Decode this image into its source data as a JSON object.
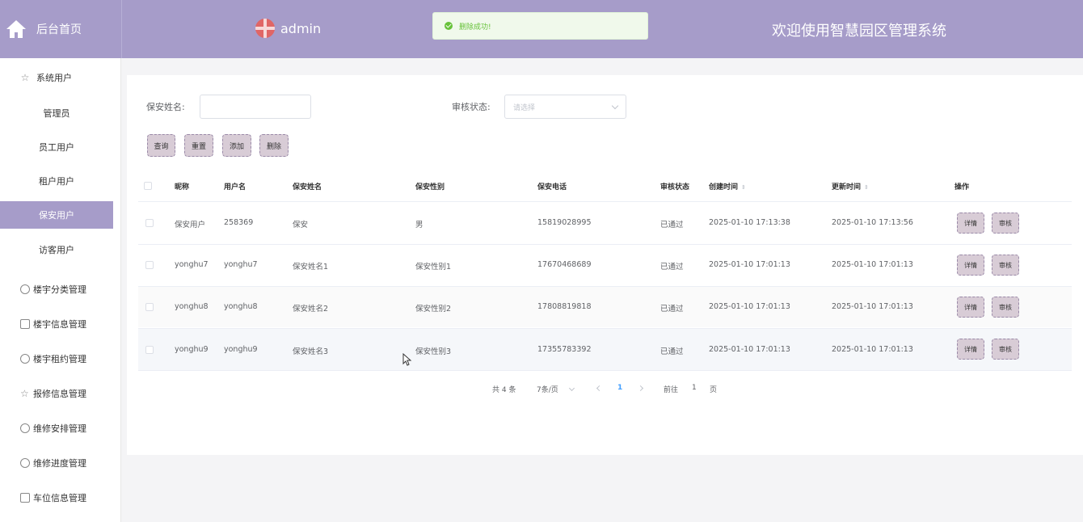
{
  "header": {
    "home_label": "后台首页",
    "username": "admin",
    "toast": "删除成功!",
    "system_title": "欢迎使用智慧园区管理系统",
    "accent": "#a69cc9"
  },
  "sidebar": {
    "group_system_users": "系统用户",
    "sub_items": [
      "管理员",
      "员工用户",
      "租户用户",
      "保安用户",
      "访客用户"
    ],
    "active_sub": "保安用户",
    "groups": [
      "楼宇分类管理",
      "楼宇信息管理",
      "楼宇租约管理",
      "报修信息管理",
      "维修安排管理",
      "维修进度管理",
      "车位信息管理"
    ]
  },
  "search": {
    "name_label": "保安姓名:",
    "name_value": "",
    "status_label": "审核状态:",
    "status_placeholder": "请选择"
  },
  "buttons": {
    "query": "查询",
    "reset": "重置",
    "add": "添加",
    "delete": "删除"
  },
  "table": {
    "headers": [
      "昵称",
      "用户名",
      "保安姓名",
      "保安性别",
      "保安电话",
      "审核状态",
      "创建时间",
      "更新时间",
      "操作"
    ],
    "rows": [
      {
        "nick": "保安用户",
        "username": "258369",
        "name": "保安",
        "gender": "男",
        "phone": "15819028995",
        "status": "已通过",
        "created": "2025-01-10 17:13:38",
        "updated": "2025-01-10 17:13:56"
      },
      {
        "nick": "yonghu7",
        "username": "yonghu7",
        "name": "保安姓名1",
        "gender": "保安性别1",
        "phone": "17670468689",
        "status": "已通过",
        "created": "2025-01-10 17:01:13",
        "updated": "2025-01-10 17:01:13"
      },
      {
        "nick": "yonghu8",
        "username": "yonghu8",
        "name": "保安姓名2",
        "gender": "保安性别2",
        "phone": "17808819818",
        "status": "已通过",
        "created": "2025-01-10 17:01:13",
        "updated": "2025-01-10 17:01:13"
      },
      {
        "nick": "yonghu9",
        "username": "yonghu9",
        "name": "保安姓名3",
        "gender": "保安性别3",
        "phone": "17355783392",
        "status": "已通过",
        "created": "2025-01-10 17:01:13",
        "updated": "2025-01-10 17:01:13"
      }
    ],
    "detail_label": "详情",
    "audit_label": "审核"
  },
  "pagination": {
    "total": "共 4 条",
    "page_size": "7条/页",
    "current": "1",
    "goto_prefix": "前往",
    "goto_value": "1",
    "goto_suffix": "页"
  }
}
